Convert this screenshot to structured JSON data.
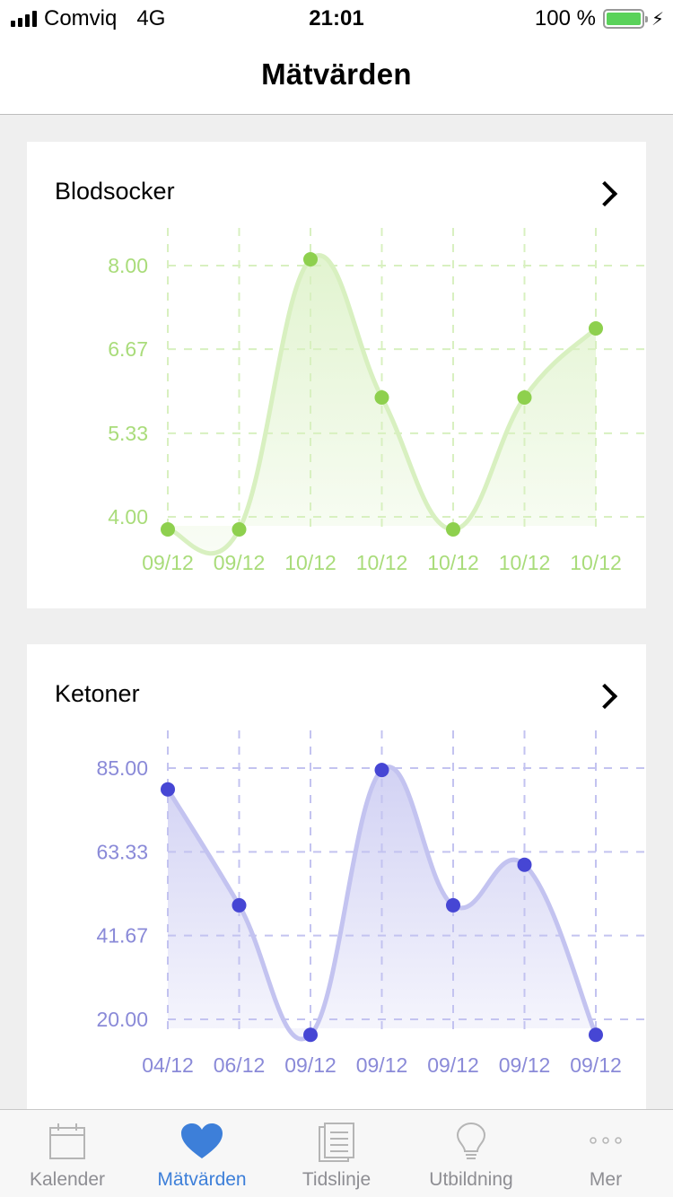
{
  "status_bar": {
    "carrier": "Comviq",
    "network": "4G",
    "time": "21:01",
    "battery": "100 %",
    "battery_level": 1.0
  },
  "nav": {
    "title": "Mätvärden"
  },
  "cards": [
    {
      "title": "Blodsocker",
      "color": "#8ed04e",
      "line_color": "#d8f0c0",
      "label_color": "#a9dc7a",
      "y_ticks": [
        "8.00",
        "6.67",
        "5.33",
        "4.00"
      ],
      "x_labels": [
        "09/12",
        "09/12",
        "10/12",
        "10/12",
        "10/12",
        "10/12",
        "10/12"
      ]
    },
    {
      "title": "Ketoner",
      "color": "#4646d4",
      "line_color": "#c3c3f0",
      "label_color": "#8a8ad8",
      "y_ticks": [
        "85.00",
        "63.33",
        "41.67",
        "20.00"
      ],
      "x_labels": [
        "04/12",
        "06/12",
        "09/12",
        "09/12",
        "09/12",
        "09/12",
        "09/12"
      ]
    }
  ],
  "chart_data": [
    {
      "type": "area",
      "title": "Blodsocker",
      "x": [
        "09/12",
        "09/12",
        "10/12",
        "10/12",
        "10/12",
        "10/12",
        "10/12"
      ],
      "values": [
        3.8,
        3.8,
        8.1,
        5.9,
        3.8,
        5.9,
        7.0
      ],
      "ylim": [
        4.0,
        8.0
      ],
      "yticks": [
        4.0,
        5.33,
        6.67,
        8.0
      ],
      "grid": true
    },
    {
      "type": "area",
      "title": "Ketoner",
      "x": [
        "04/12",
        "06/12",
        "09/12",
        "09/12",
        "09/12",
        "09/12",
        "09/12"
      ],
      "values": [
        79.5,
        49.5,
        16.0,
        84.5,
        49.5,
        60.0,
        16.0
      ],
      "ylim": [
        20.0,
        85.0
      ],
      "yticks": [
        20.0,
        41.67,
        63.33,
        85.0
      ],
      "grid": true
    }
  ],
  "tabs": [
    {
      "label": "Kalender",
      "icon": "calendar-icon",
      "active": false
    },
    {
      "label": "Mätvärden",
      "icon": "heart-icon",
      "active": true
    },
    {
      "label": "Tidslinje",
      "icon": "document-icon",
      "active": false
    },
    {
      "label": "Utbildning",
      "icon": "lightbulb-icon",
      "active": false
    },
    {
      "label": "Mer",
      "icon": "more-icon",
      "active": false
    }
  ]
}
